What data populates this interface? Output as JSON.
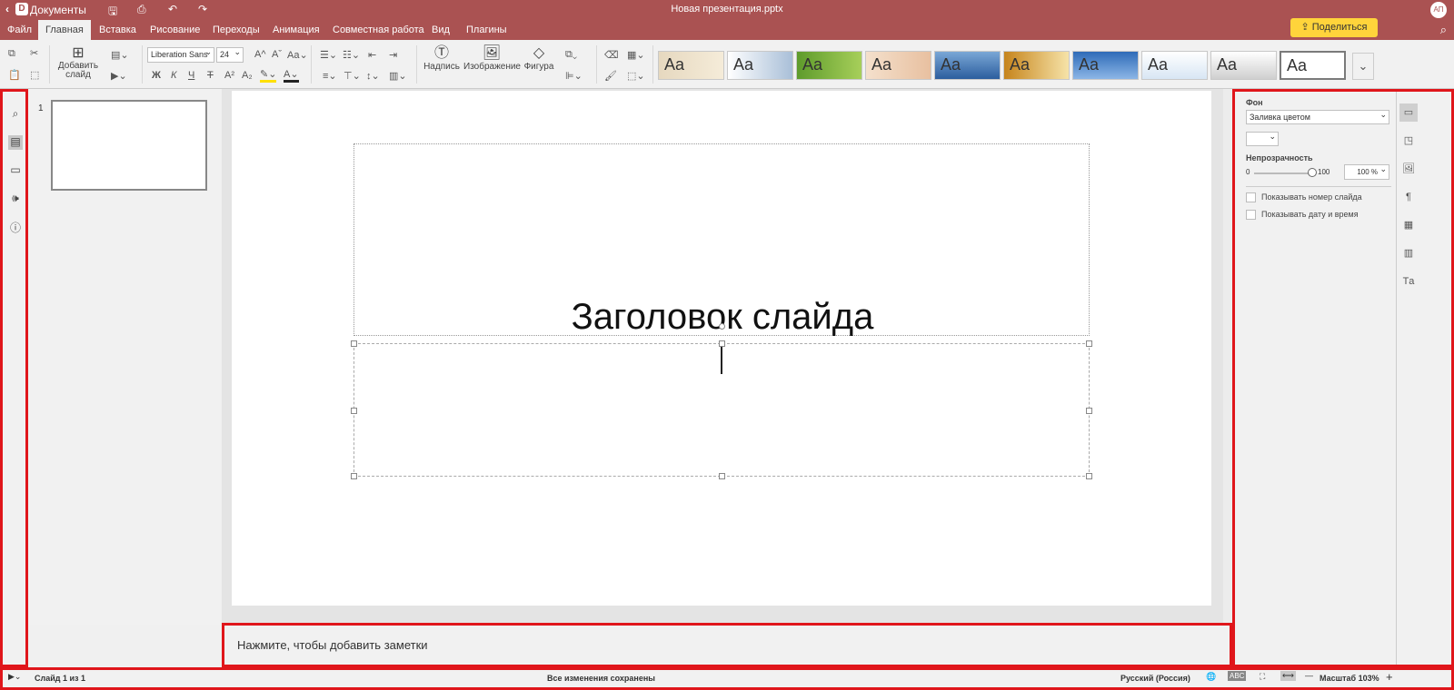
{
  "titlebar": {
    "app_name": "Документы",
    "document_title": "Новая презентация.pptx",
    "user_initials": "АП"
  },
  "menu": {
    "tabs": [
      "Файл",
      "Главная",
      "Вставка",
      "Рисование",
      "Переходы",
      "Анимация",
      "Совместная работа",
      "Вид",
      "Плагины"
    ],
    "active_tab": "Главная",
    "share_label": "Поделиться"
  },
  "toolbar": {
    "add_slide_label": "Добавить слайд",
    "font_name": "Liberation Sans",
    "font_size": "24",
    "bold": "Ж",
    "italic": "К",
    "underline": "Ч",
    "strike": "Т",
    "textbox_label": "Надпись",
    "image_label": "Изображение",
    "shape_label": "Фигура",
    "theme_sample": "Aa"
  },
  "thumbnails": {
    "slide_number": "1"
  },
  "slide": {
    "title_text": "Заголовок слайда"
  },
  "notes": {
    "placeholder": "Нажмите, чтобы добавить заметки"
  },
  "right_panel": {
    "background_label": "Фон",
    "fill_type": "Заливка цветом",
    "opacity_label": "Непрозрачность",
    "slider_min": "0",
    "slider_max": "100",
    "opacity_value": "100 %",
    "show_slide_number": "Показывать номер слайда",
    "show_datetime": "Показывать дату и время"
  },
  "status": {
    "slide_info": "Слайд 1 из 1",
    "save_state": "Все изменения сохранены",
    "language": "Русский (Россия)",
    "zoom_label": "Масштаб 103%"
  }
}
